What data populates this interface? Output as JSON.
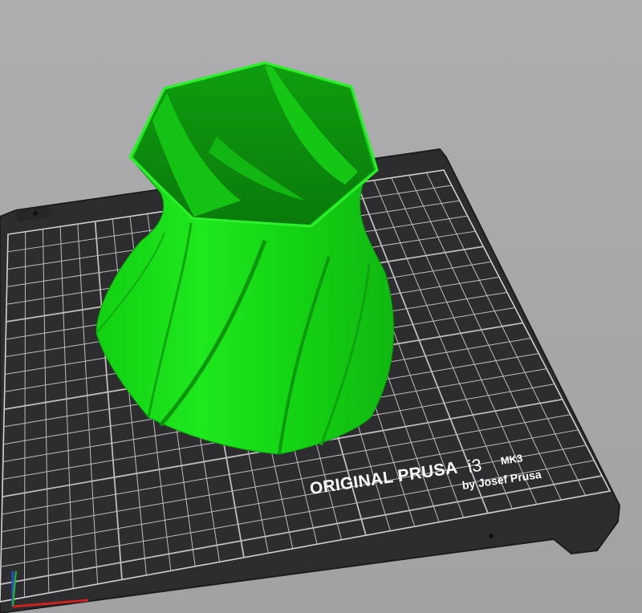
{
  "print_bed": {
    "brand_line": "ORIGINAL PRUSA",
    "model": "i3",
    "model_suffix": "MK3",
    "byline": "by Josef Prusa"
  },
  "model_object": {
    "color": "#19e619"
  },
  "axes": {
    "x_color": "#cc2222",
    "y_color": "#22bb22",
    "z_color": "#2255cc"
  },
  "colors": {
    "background": "#a9a9ab",
    "bed": "#2f2f31",
    "grid": "#c8c8c8"
  }
}
